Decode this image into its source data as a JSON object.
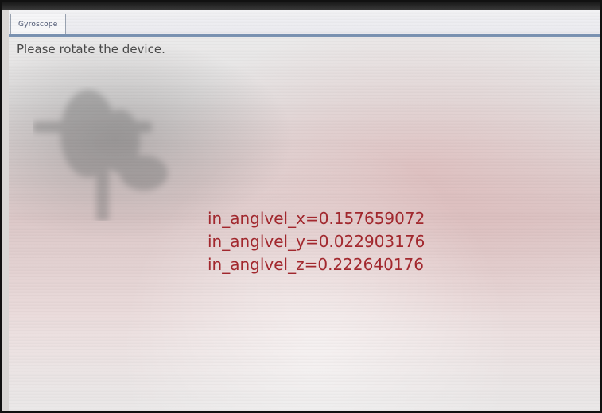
{
  "window": {
    "tab_label": "Gyroscope"
  },
  "main": {
    "instruction": "Please rotate the device.",
    "readings": [
      "in_anglvel_x=0.157659072",
      "in_anglvel_y=0.022903176",
      "in_anglvel_z=0.222640176"
    ]
  },
  "colors": {
    "reading_text": "#a3282e",
    "tab_underline": "#7b93b3"
  }
}
